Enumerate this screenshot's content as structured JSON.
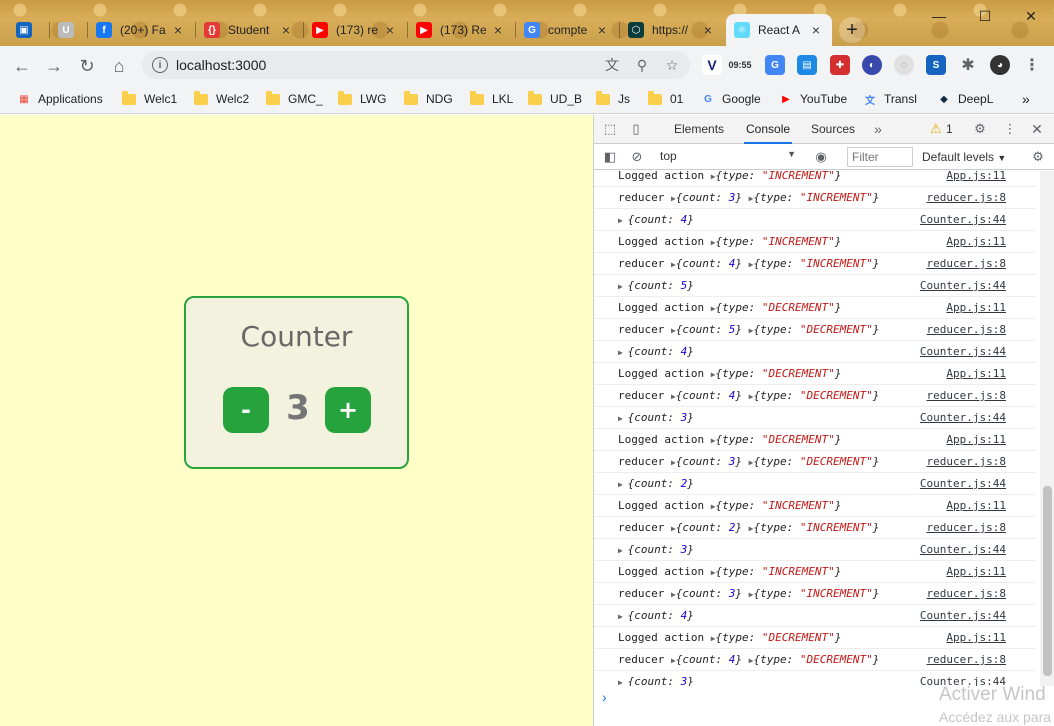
{
  "browser": {
    "tabs": [
      {
        "title": "",
        "fav_color": "#1565c0",
        "icon": "screen-icon"
      },
      {
        "title": "",
        "fav_color": "#bbbbbb",
        "icon": "u-icon"
      },
      {
        "title": "(20+) Fa",
        "fav_color": "#1877f2",
        "icon": "facebook-icon"
      },
      {
        "title": "Student",
        "fav_color": "#e53935",
        "icon": "student-icon"
      },
      {
        "title": "(173) re",
        "fav_color": "#ff0000",
        "icon": "youtube-icon"
      },
      {
        "title": "(173) Re",
        "fav_color": "#ff0000",
        "icon": "youtube-icon"
      },
      {
        "title": "compte",
        "fav_color": "#4285f4",
        "icon": "google-icon"
      },
      {
        "title": "https://",
        "fav_color": "#0b3b3b",
        "icon": "codesandbox-icon"
      },
      {
        "title": "React A",
        "fav_color": "#61dafb",
        "icon": "react-icon"
      }
    ],
    "url": "localhost:3000",
    "clock_ext": "09:55",
    "bookmarks": [
      {
        "label": "Applications",
        "kind": "apps"
      },
      {
        "label": "Welc1",
        "kind": "folder"
      },
      {
        "label": "Welc2",
        "kind": "folder"
      },
      {
        "label": "GMC_",
        "kind": "folder"
      },
      {
        "label": "LWG",
        "kind": "folder"
      },
      {
        "label": "NDG",
        "kind": "folder"
      },
      {
        "label": "LKL",
        "kind": "folder"
      },
      {
        "label": "UD_B",
        "kind": "folder"
      },
      {
        "label": "Js",
        "kind": "folder"
      },
      {
        "label": "01",
        "kind": "folder"
      },
      {
        "label": "Google",
        "kind": "google"
      },
      {
        "label": "YouTube",
        "kind": "youtube"
      },
      {
        "label": "Transl",
        "kind": "translate"
      },
      {
        "label": "DeepL",
        "kind": "deepl"
      }
    ]
  },
  "app": {
    "title": "Counter",
    "count": "3",
    "minus_label": "-",
    "plus_label": "+",
    "accent": "#27a33e",
    "background": "#ffffc8"
  },
  "devtools": {
    "tabs": [
      "Elements",
      "Console",
      "Sources"
    ],
    "active_tab": "Console",
    "warnings": "1",
    "context": "top",
    "filter_placeholder": "Filter",
    "levels": "Default levels",
    "logs": [
      {
        "kind": "logged",
        "label": "Logged action",
        "type": "INCREMENT",
        "src": "App.js:11"
      },
      {
        "kind": "reducer",
        "label": "reducer",
        "count": "3",
        "type": "INCREMENT",
        "src": "reducer.js:8"
      },
      {
        "kind": "count",
        "count": "4",
        "src": "Counter.js:44"
      },
      {
        "kind": "logged",
        "label": "Logged action",
        "type": "INCREMENT",
        "src": "App.js:11"
      },
      {
        "kind": "reducer",
        "label": "reducer",
        "count": "4",
        "type": "INCREMENT",
        "src": "reducer.js:8"
      },
      {
        "kind": "count",
        "count": "5",
        "src": "Counter.js:44"
      },
      {
        "kind": "logged",
        "label": "Logged action",
        "type": "DECREMENT",
        "src": "App.js:11"
      },
      {
        "kind": "reducer",
        "label": "reducer",
        "count": "5",
        "type": "DECREMENT",
        "src": "reducer.js:8"
      },
      {
        "kind": "count",
        "count": "4",
        "src": "Counter.js:44"
      },
      {
        "kind": "logged",
        "label": "Logged action",
        "type": "DECREMENT",
        "src": "App.js:11"
      },
      {
        "kind": "reducer",
        "label": "reducer",
        "count": "4",
        "type": "DECREMENT",
        "src": "reducer.js:8"
      },
      {
        "kind": "count",
        "count": "3",
        "src": "Counter.js:44"
      },
      {
        "kind": "logged",
        "label": "Logged action",
        "type": "DECREMENT",
        "src": "App.js:11"
      },
      {
        "kind": "reducer",
        "label": "reducer",
        "count": "3",
        "type": "DECREMENT",
        "src": "reducer.js:8"
      },
      {
        "kind": "count",
        "count": "2",
        "src": "Counter.js:44"
      },
      {
        "kind": "logged",
        "label": "Logged action",
        "type": "INCREMENT",
        "src": "App.js:11"
      },
      {
        "kind": "reducer",
        "label": "reducer",
        "count": "2",
        "type": "INCREMENT",
        "src": "reducer.js:8"
      },
      {
        "kind": "count",
        "count": "3",
        "src": "Counter.js:44"
      },
      {
        "kind": "logged",
        "label": "Logged action",
        "type": "INCREMENT",
        "src": "App.js:11"
      },
      {
        "kind": "reducer",
        "label": "reducer",
        "count": "3",
        "type": "INCREMENT",
        "src": "reducer.js:8"
      },
      {
        "kind": "count",
        "count": "4",
        "src": "Counter.js:44"
      },
      {
        "kind": "logged",
        "label": "Logged action",
        "type": "DECREMENT",
        "src": "App.js:11"
      },
      {
        "kind": "reducer",
        "label": "reducer",
        "count": "4",
        "type": "DECREMENT",
        "src": "reducer.js:8"
      },
      {
        "kind": "count",
        "count": "3",
        "src": "Counter.js:44"
      }
    ]
  },
  "watermark": {
    "line1": "Activer Wind",
    "line2": "Accédez aux para"
  }
}
